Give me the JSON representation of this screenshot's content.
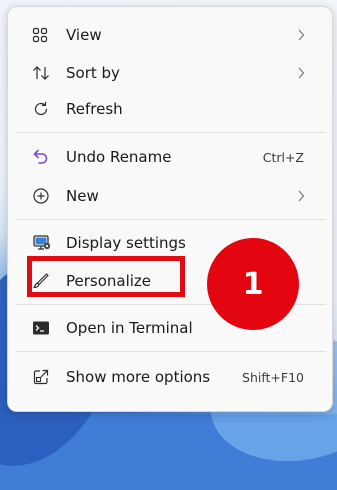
{
  "menu": {
    "items": [
      {
        "label": "View",
        "icon": "grid-view-icon",
        "has_submenu": true
      },
      {
        "label": "Sort by",
        "icon": "sort-icon",
        "has_submenu": true
      },
      {
        "label": "Refresh",
        "icon": "refresh-icon",
        "has_submenu": false
      },
      {
        "label": "Undo Rename",
        "icon": "undo-icon",
        "shortcut": "Ctrl+Z"
      },
      {
        "label": "New",
        "icon": "add-circle-icon",
        "has_submenu": true
      },
      {
        "label": "Display settings",
        "icon": "display-icon",
        "has_submenu": false
      },
      {
        "label": "Personalize",
        "icon": "brush-icon",
        "has_submenu": false
      },
      {
        "label": "Open in Terminal",
        "icon": "terminal-icon",
        "has_submenu": false
      },
      {
        "label": "Show more options",
        "icon": "share-out-icon",
        "shortcut": "Shift+F10"
      }
    ]
  },
  "annotation": {
    "step_number": "1",
    "color": "#e30611"
  }
}
